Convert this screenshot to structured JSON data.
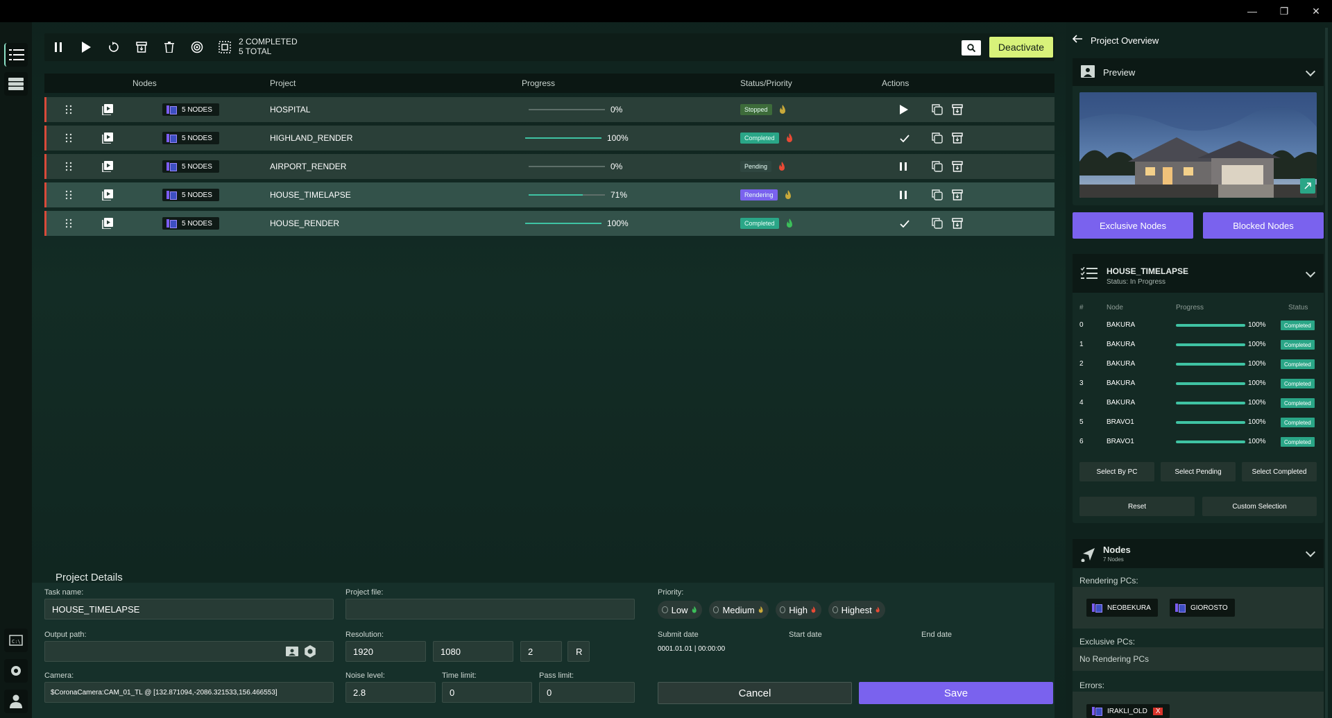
{
  "window": {
    "minimize": "—",
    "maximize": "❐",
    "close": "✕"
  },
  "toolbar": {
    "completed": "2 COMPLETED",
    "total": "5 TOTAL",
    "deactivate": "Deactivate"
  },
  "table": {
    "headers": {
      "nodes": "Nodes",
      "project": "Project",
      "progress": "Progress",
      "status": "Status/Priority",
      "actions": "Actions"
    },
    "rows": [
      {
        "nodes": "5 NODES",
        "project": "HOSPITAL",
        "progress": 0,
        "progress_label": "0%",
        "status": "Stopped",
        "status_color": "#3d6b3a",
        "flame": "#c9a93a",
        "action": "play"
      },
      {
        "nodes": "5 NODES",
        "project": "HIGHLAND_RENDER",
        "progress": 100,
        "progress_label": "100%",
        "status": "Completed",
        "status_color": "#2aa687",
        "flame": "#e84a35",
        "action": "check"
      },
      {
        "nodes": "5 NODES",
        "project": "AIRPORT_RENDER",
        "progress": 0,
        "progress_label": "0%",
        "status": "Pending",
        "status_color": "#2f4640",
        "flame": "#e84a35",
        "action": "pause"
      },
      {
        "nodes": "5 NODES",
        "project": "HOUSE_TIMELAPSE",
        "progress": 71,
        "progress_label": "71%",
        "status": "Rendering",
        "status_color": "#7a62ee",
        "flame": "#c9a93a",
        "action": "pause"
      },
      {
        "nodes": "5 NODES",
        "project": "HOUSE_RENDER",
        "progress": 100,
        "progress_label": "100%",
        "status": "Completed",
        "status_color": "#2aa687",
        "flame": "#3cbf5a",
        "action": "check"
      }
    ]
  },
  "details": {
    "title": "Project Details",
    "task_name_label": "Task name:",
    "task_name": "HOUSE_TIMELAPSE",
    "project_file_label": "Project file:",
    "project_file": "",
    "priority_label": "Priority:",
    "priorities": [
      "Low",
      "Medium",
      "High",
      "Highest"
    ],
    "output_path_label": "Output path:",
    "output_path": "",
    "resolution_label": "Resolution:",
    "res_w": "1920",
    "res_h": "1080",
    "res_mult": "2",
    "res_r": "R",
    "submit_label": "Submit date",
    "submit_value": "0001.01.01 | 00:00:00",
    "start_label": "Start date",
    "end_label": "End date",
    "camera_label": "Camera:",
    "camera": "$CoronaCamera:CAM_01_TL @ [132.871094,-2086.321533,156.466553]",
    "noise_label": "Noise level:",
    "noise": "2.8",
    "time_label": "Time limit:",
    "time": "0",
    "pass_label": "Pass limit:",
    "pass": "0",
    "cancel": "Cancel",
    "save": "Save"
  },
  "panel": {
    "title": "Project Overview",
    "preview": "Preview",
    "exclusive_nodes": "Exclusive Nodes",
    "blocked_nodes": "Blocked Nodes",
    "task_title": "HOUSE_TIMELAPSE",
    "task_status": "Status: In Progress",
    "node_headers": {
      "num": "#",
      "node": "Node",
      "progress": "Progress",
      "status": "Status"
    },
    "node_rows": [
      {
        "num": "0",
        "node": "BAKURA",
        "pct": "100%",
        "status": "Completed"
      },
      {
        "num": "1",
        "node": "BAKURA",
        "pct": "100%",
        "status": "Completed"
      },
      {
        "num": "2",
        "node": "BAKURA",
        "pct": "100%",
        "status": "Completed"
      },
      {
        "num": "3",
        "node": "BAKURA",
        "pct": "100%",
        "status": "Completed"
      },
      {
        "num": "4",
        "node": "BAKURA",
        "pct": "100%",
        "status": "Completed"
      },
      {
        "num": "5",
        "node": "BRAVO1",
        "pct": "100%",
        "status": "Completed"
      },
      {
        "num": "6",
        "node": "BRAVO1",
        "pct": "100%",
        "status": "Completed"
      }
    ],
    "select_by_pc": "Select By PC",
    "select_pending": "Select Pending",
    "select_completed": "Select Completed",
    "reset": "Reset",
    "custom_selection": "Custom Selection",
    "nodes_title": "Nodes",
    "nodes_count": "7 Nodes",
    "rendering_pcs_label": "Rendering PCs:",
    "rendering_pcs": [
      "NEOBEKURA",
      "GIOROSTO"
    ],
    "exclusive_pcs_label": "Exclusive PCs:",
    "exclusive_pcs_value": "No Rendering PCs",
    "errors_label": "Errors:",
    "error_pcs": [
      "IRAKLI_OLD"
    ],
    "error_remove": "X"
  }
}
